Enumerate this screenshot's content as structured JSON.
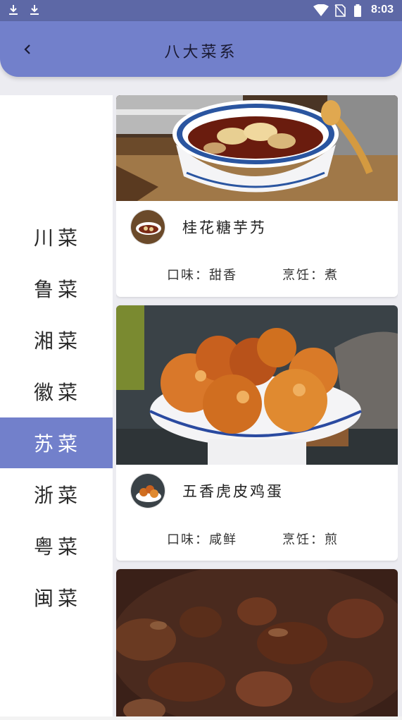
{
  "status_bar": {
    "time": "8:03",
    "icons": [
      "download-icon",
      "download-icon",
      "wifi-icon",
      "no-sim-icon",
      "battery-icon"
    ]
  },
  "app_bar": {
    "title": "八大菜系",
    "back_icon": "chevron-left-icon"
  },
  "sidebar": {
    "items": [
      {
        "label": "川菜",
        "active": false
      },
      {
        "label": "鲁菜",
        "active": false
      },
      {
        "label": "湘菜",
        "active": false
      },
      {
        "label": "徽菜",
        "active": false
      },
      {
        "label": "苏菜",
        "active": true
      },
      {
        "label": "浙菜",
        "active": false
      },
      {
        "label": "粤菜",
        "active": false
      },
      {
        "label": "闽菜",
        "active": false
      }
    ]
  },
  "dishes": [
    {
      "name": "桂花糖芋艿",
      "taste": "口味：甜香",
      "cook": "烹饪：煮"
    },
    {
      "name": "五香虎皮鸡蛋",
      "taste": "口味：咸鲜",
      "cook": "烹饪：煎"
    }
  ],
  "colors": {
    "accent": "#7280cb",
    "status_bar": "#5d68a6"
  }
}
